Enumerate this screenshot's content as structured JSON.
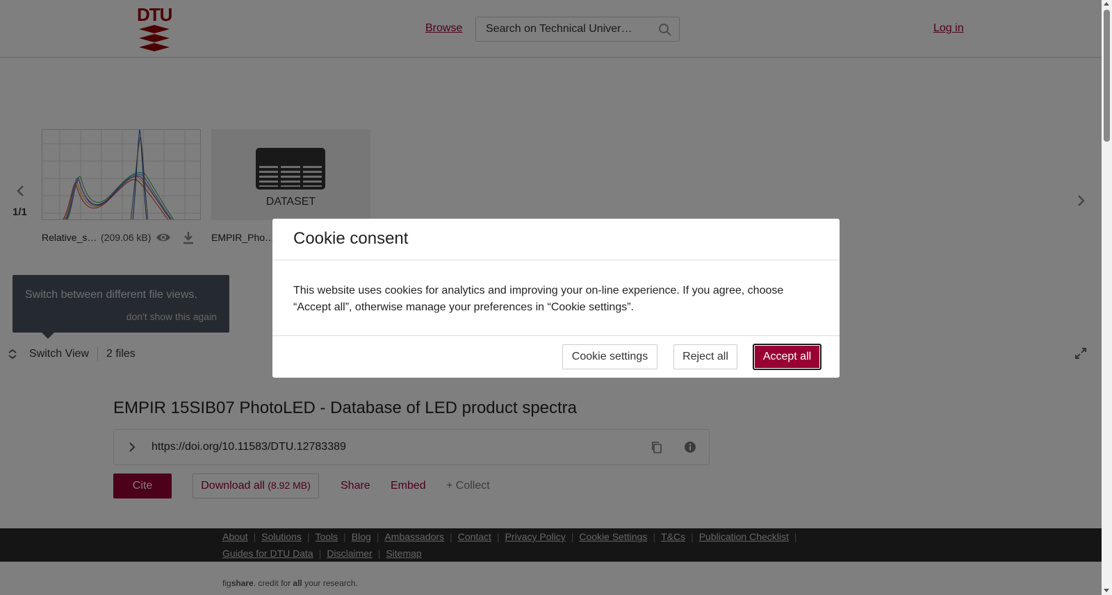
{
  "header": {
    "logo_text": "DTU",
    "browse_label": "Browse",
    "search_placeholder": "Search on Technical Univer…",
    "login_label": "Log in"
  },
  "viewer": {
    "page_count": "1/1",
    "files": [
      {
        "name": "Relative_s…",
        "size": "(209.06 kB)"
      },
      {
        "name": "EMPIR_Pho…",
        "type_label": "DATASET"
      }
    ],
    "tooltip": {
      "text": "Switch between different file views.",
      "dismiss": "don't show this again"
    },
    "switch_view_label": "Switch View",
    "files_count": "2 files"
  },
  "item": {
    "title": "EMPIR 15SIB07 PhotoLED - Database of LED product spectra",
    "doi": "https://doi.org/10.11583/DTU.12783389",
    "cite_label": "Cite",
    "download_label": "Download all",
    "download_size": "(8.92 MB)",
    "share_label": "Share",
    "embed_label": "Embed",
    "collect_label": "+ Collect"
  },
  "footer": {
    "links": [
      "About",
      "Solutions",
      "Tools",
      "Blog",
      "Ambassadors",
      "Contact",
      "Privacy Policy",
      "Cookie Settings",
      "T&Cs",
      "Publication Checklist",
      "Guides for DTU Data",
      "Disclaimer",
      "Sitemap"
    ],
    "credit_prefix": "fig",
    "credit_brand": "share",
    "credit_mid": ". credit for ",
    "credit_all": "all",
    "credit_suffix": " your research."
  },
  "cookie_modal": {
    "title": "Cookie consent",
    "body": "This website uses cookies for analytics and improving your on-line experience. If you agree, choose “Accept all”, otherwise manage your preferences in “Cookie settings”.",
    "settings_label": "Cookie settings",
    "reject_label": "Reject all",
    "accept_label": "Accept all"
  },
  "colors": {
    "brand": "#990033",
    "link": "#99003d",
    "footer_bg": "#2b2b2b"
  }
}
